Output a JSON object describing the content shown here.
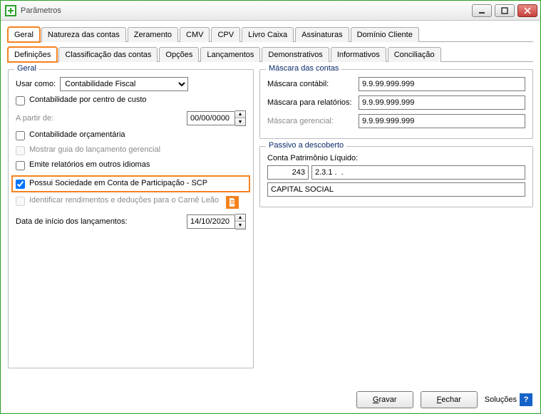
{
  "window": {
    "title": "Parâmetros"
  },
  "tabs_main": {
    "items": [
      {
        "id": "geral",
        "label": "Geral",
        "active": true,
        "hl": true
      },
      {
        "id": "natureza",
        "label": "Natureza das contas"
      },
      {
        "id": "zeramento",
        "label": "Zeramento"
      },
      {
        "id": "cmv",
        "label": "CMV"
      },
      {
        "id": "cpv",
        "label": "CPV"
      },
      {
        "id": "livro",
        "label": "Livro Caixa"
      },
      {
        "id": "assin",
        "label": "Assinaturas"
      },
      {
        "id": "dominio",
        "label": "Domínio Cliente"
      }
    ]
  },
  "tabs_sub": {
    "items": [
      {
        "id": "definicoes",
        "label": "Definições",
        "active": true,
        "hl": true
      },
      {
        "id": "class",
        "label": "Classificação das contas"
      },
      {
        "id": "opcoes",
        "label": "Opções"
      },
      {
        "id": "lanc",
        "label": "Lançamentos"
      },
      {
        "id": "demo",
        "label": "Demonstrativos"
      },
      {
        "id": "info",
        "label": "Informativos"
      },
      {
        "id": "concil",
        "label": "Conciliação"
      }
    ]
  },
  "geral_group": {
    "title": "Geral",
    "usar_como_label": "Usar como:",
    "usar_como_value": "Contabilidade Fiscal",
    "cb_centro_custo": "Contabilidade por centro de custo",
    "a_partir_de_label": "A partir de:",
    "a_partir_de_value": "00/00/0000",
    "cb_orcamentaria": "Contabilidade orçamentária",
    "cb_mostrar_guia": "Mostrar guia do lançamento gerencial",
    "cb_outros_idiomas": "Emite relatórios em outros idiomas",
    "cb_scp": "Possui Sociedade em Conta de Participação - SCP",
    "cb_carne_leao": "Identificar rendimentos e deduções para o Carnê Leão",
    "data_inicio_label": "Data de início dos lançamentos:",
    "data_inicio_value": "14/10/2020"
  },
  "mascara": {
    "title": "Máscara das contas",
    "contabil_label": "Máscara contábil:",
    "contabil_value": "9.9.99.999.999",
    "relatorios_label": "Máscara para relatórios:",
    "relatorios_value": "9.9.99.999.999",
    "gerencial_label": "Máscara gerencial:",
    "gerencial_value": "9.9.99.999.999"
  },
  "passivo": {
    "title": "Passivo a descoberto",
    "conta_label": "Conta Patrimônio Líquido:",
    "conta_num": "243",
    "conta_code": "2.3.1 .  .",
    "conta_name": "CAPITAL SOCIAL"
  },
  "footer": {
    "gravar": "Gravar",
    "fechar": "Fechar",
    "solucoes": "Soluções"
  }
}
